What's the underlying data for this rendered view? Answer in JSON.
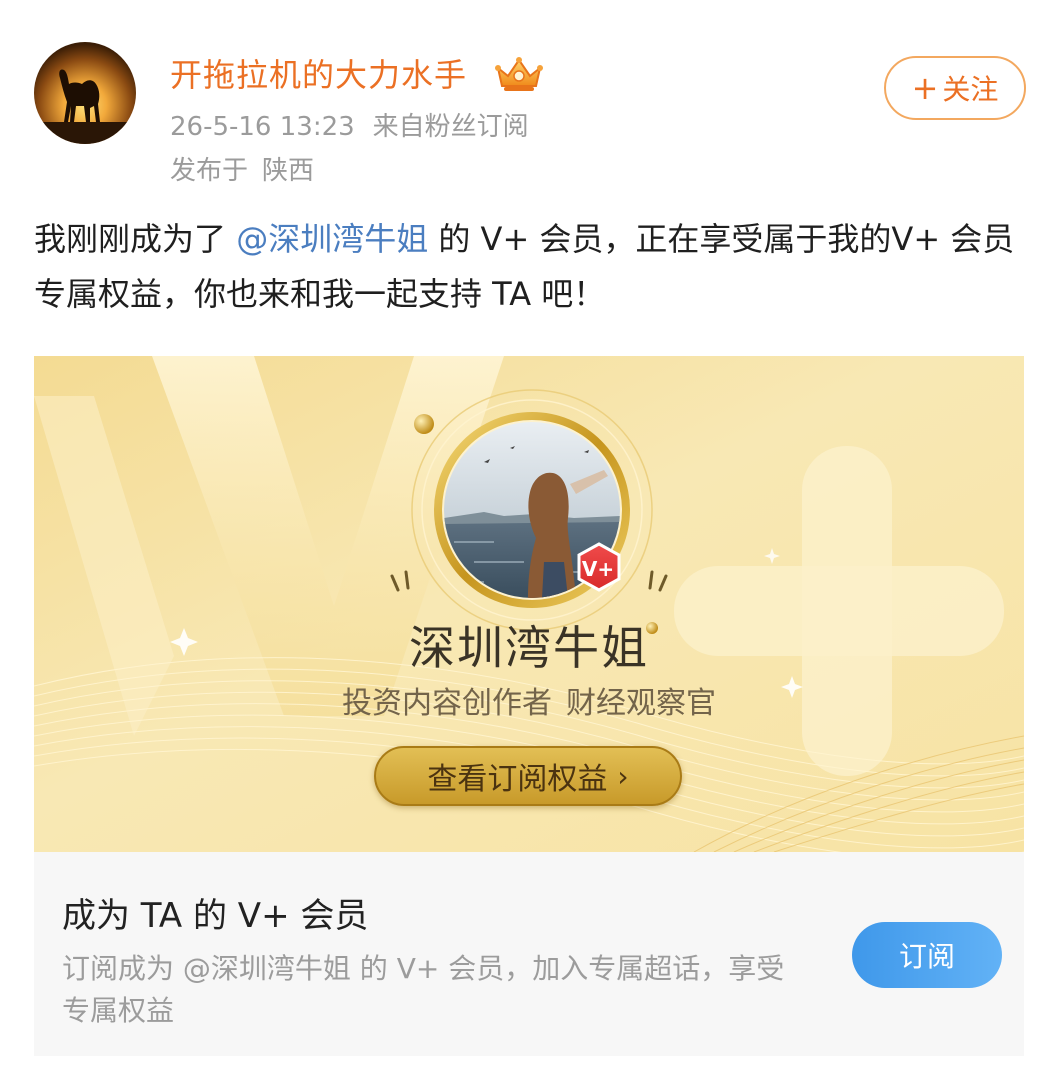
{
  "author": {
    "name": "开拖拉机的大力水手",
    "timestamp": "26-5-16 13:23",
    "source": "来自粉丝订阅",
    "location_prefix": "发布于",
    "location": "陕西",
    "badge_icon": "crown-icon"
  },
  "follow_button": {
    "plus": "+",
    "label": "关注"
  },
  "post": {
    "text_before": "我刚刚成为了 ",
    "mention": "@深圳湾牛姐",
    "text_after": " 的 V+ 会员，正在享受属于我的V+ 会员专属权益，你也来和我一起支持 TA 吧！"
  },
  "card": {
    "badge_text": "V+",
    "creator_name": "深圳湾牛姐",
    "tags": [
      "投资内容创作者",
      "财经观察官"
    ],
    "view_benefits_label": "查看订阅权益",
    "member_title": "成为 TA 的 V+ 会员",
    "member_desc": "订阅成为 @深圳湾牛姐 的 V+ 会员，加入专属超话，享受专属权益",
    "subscribe_label": "订阅"
  },
  "colors": {
    "username": "#eb7024",
    "mention": "#4b7ec0",
    "subscribe": "#4ba3ee",
    "gold": "#d4ad3c"
  }
}
